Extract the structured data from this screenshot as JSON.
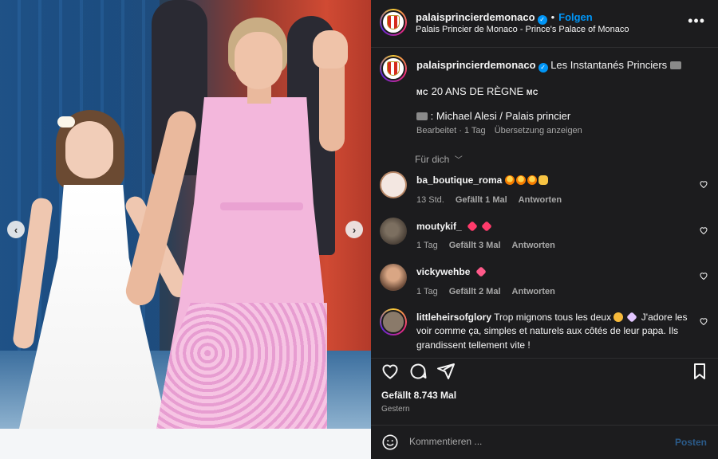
{
  "post": {
    "username": "palaisprincierdemonaco",
    "verified": true,
    "follow_label": "Folgen",
    "location": "Palais Princier de Monaco - Prince's Palace of Monaco",
    "more_label": "•••"
  },
  "caption": {
    "text_line1": "Les Instantanés Princiers",
    "mc_left": "MC",
    "text_line2": "20 ANS DE RÈGNE",
    "mc_right": "MC",
    "text_line3": ": Michael Alesi / Palais princier",
    "edited": "Bearbeitet",
    "age": "1 Tag",
    "translate": "Übersetzung anzeigen"
  },
  "for_you_label": "Für dich",
  "comments": [
    {
      "username": "ba_boutique_roma",
      "text": "",
      "age": "13 Std.",
      "likes": "Gefällt 1 Mal",
      "reply": "Antworten",
      "emojis": [
        "star",
        "star",
        "star",
        "clap"
      ]
    },
    {
      "username": "moutykif_",
      "text": "",
      "age": "1 Tag",
      "likes": "Gefällt 3 Mal",
      "reply": "Antworten",
      "emojis": [
        "heart",
        "heart"
      ]
    },
    {
      "username": "vickywehbe",
      "text": "",
      "age": "1 Tag",
      "likes": "Gefällt 2 Mal",
      "reply": "Antworten",
      "emojis": [
        "pulse"
      ]
    },
    {
      "username": "littleheirsofglory",
      "text_a": "Trop mignons tous les deux",
      "text_b": "J'adore les",
      "text_line2": "voir comme ça, simples et naturels aux côtés de leur papa. Ils",
      "text_line3": "grandissent tellement vite !",
      "emojis": [
        "sad",
        "purple"
      ]
    }
  ],
  "stats": {
    "likes": "Gefällt 8.743 Mal",
    "posted": "Gestern"
  },
  "comment_box": {
    "placeholder": "Kommentieren ...",
    "post_label": "Posten"
  },
  "icons": {
    "prev": "chevron-left",
    "next": "chevron-right",
    "like": "heart-outline",
    "comment": "speech-bubble",
    "share": "paper-plane",
    "save": "bookmark",
    "emoji": "smiley"
  },
  "colors": {
    "panel_bg": "#1c1c1e",
    "accent_blue": "#0095f6",
    "muted_text": "#a8a8a8"
  }
}
